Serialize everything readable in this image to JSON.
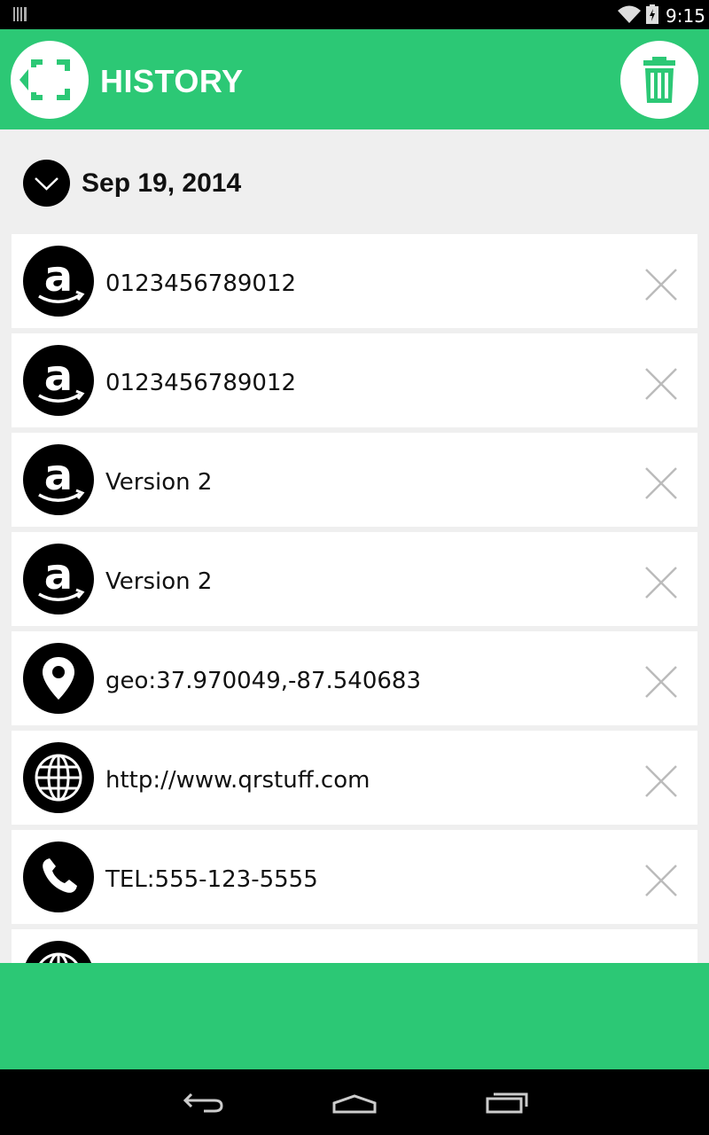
{
  "status_bar": {
    "time": "9:15"
  },
  "app_bar": {
    "title": "HISTORY",
    "accent_color": "#2cc875"
  },
  "date_group": {
    "label": "Sep 19, 2014"
  },
  "items": [
    {
      "icon": "amazon-icon",
      "text": "0123456789012"
    },
    {
      "icon": "amazon-icon",
      "text": "0123456789012"
    },
    {
      "icon": "amazon-icon",
      "text": "Version 2"
    },
    {
      "icon": "amazon-icon",
      "text": "Version 2"
    },
    {
      "icon": "map-pin-icon",
      "text": "geo:37.970049,-87.540683"
    },
    {
      "icon": "globe-icon",
      "text": "http://www.qrstuff.com"
    },
    {
      "icon": "phone-icon",
      "text": "TEL:555-123-5555"
    },
    {
      "icon": "globe-icon",
      "text": ""
    }
  ]
}
